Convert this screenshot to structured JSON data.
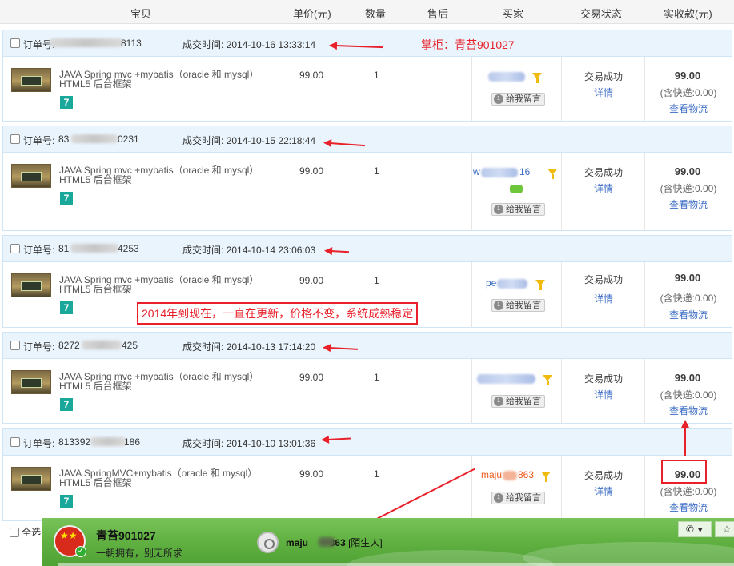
{
  "columns": [
    "宝贝",
    "单价(元)",
    "数量",
    "售后",
    "买家",
    "交易状态",
    "实收款(元)"
  ],
  "order_label": "订单号:",
  "time_label": "成交时间:",
  "orders": [
    {
      "order_prefix": "订单号: ",
      "order_suffix": "8113",
      "time": "2014-10-16 13:33:14",
      "title": "JAVA Spring mvc +mybatis（oracle 和 mysql） HTML5 后台框架",
      "price": "99.00",
      "qty": "1",
      "buyer": "",
      "status": "交易成功",
      "detail": "详情",
      "amount": "99.00",
      "shipping": "(含快递:0.00)",
      "logistics": "查看物流",
      "message": "给我留言"
    },
    {
      "order_prefix": "83",
      "order_suffix": "0231",
      "time": "2014-10-15 22:18:44",
      "title": "JAVA Spring mvc +mybatis（oracle 和 mysql） HTML5 后台框架",
      "price": "99.00",
      "qty": "1",
      "buyer_prefix": "w",
      "buyer_suffix": "16",
      "status": "交易成功",
      "detail": "详情",
      "amount": "99.00",
      "shipping": "(含快递:0.00)",
      "logistics": "查看物流",
      "message": "给我留言"
    },
    {
      "order_prefix": "81",
      "order_suffix": "4253",
      "time": "2014-10-14 23:06:03",
      "title": "JAVA Spring mvc +mybatis（oracle 和 mysql） HTML5 后台框架",
      "price": "99.00",
      "qty": "1",
      "buyer_prefix": "pe",
      "status": "交易成功",
      "detail": "详情",
      "amount": "99.00",
      "shipping": "(含快递:0.00)",
      "logistics": "查看物流",
      "message": "给我留言"
    },
    {
      "order_prefix": "8272",
      "order_suffix": "425",
      "time": "2014-10-13 17:14:20",
      "title": "JAVA Spring mvc +mybatis（oracle 和 mysql） HTML5 后台框架",
      "price": "99.00",
      "qty": "1",
      "status": "交易成功",
      "detail": "详情",
      "amount": "99.00",
      "shipping": "(含快递:0.00)",
      "logistics": "查看物流",
      "message": "给我留言"
    },
    {
      "order_prefix": "813392",
      "order_suffix": "186",
      "time": "2014-10-10 13:01:36",
      "title": "JAVA SpringMVC+mybatis（oracle 和 mysql） HTML5 后台框架",
      "price": "99.00",
      "qty": "1",
      "buyer_prefix": "maju",
      "buyer_suffix": "863",
      "status": "交易成功",
      "detail": "详情",
      "amount": "99.00",
      "shipping": "(含快递:0.00)",
      "logistics": "查看物流",
      "message": "给我留言"
    }
  ],
  "badge": "7",
  "annotations": {
    "shopkeeper": "掌柜：青苔901027",
    "note": "2014年到现在，一直在更新，价格不变，系统成熟稳定"
  },
  "select_all": "全选",
  "im": {
    "name": "青苔901027",
    "signature": "一朝拥有，别无所求",
    "contact_prefix": "maju",
    "contact_suffix": "863",
    "contact_tag": "[陌生人]",
    "phone_icon": "phone-icon",
    "chevron_icon": "chevron-down-icon",
    "star_icon": "star-icon"
  },
  "colors": {
    "accent_red": "#e8202a",
    "link_blue": "#3c6cc4",
    "header_blue": "#eaf4fc",
    "im_green": "#62b243",
    "badge_teal": "#1aa89a"
  }
}
